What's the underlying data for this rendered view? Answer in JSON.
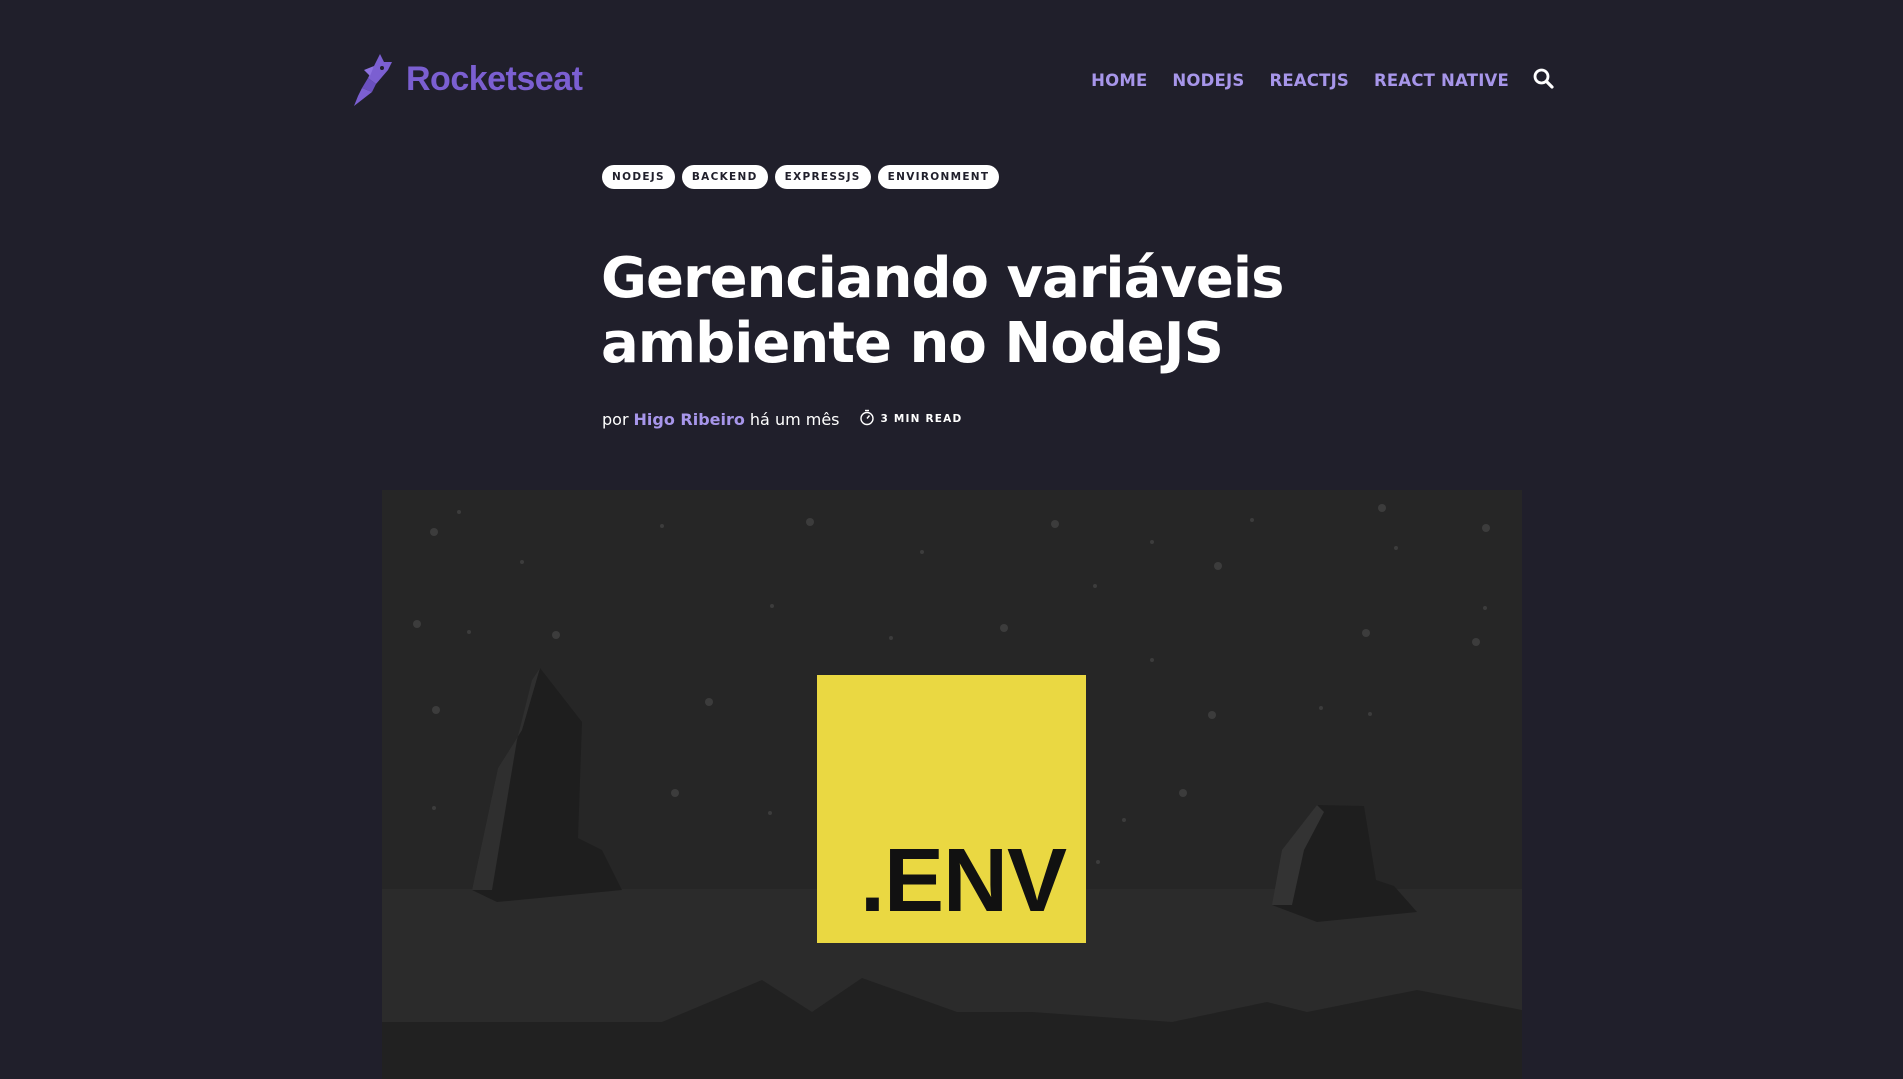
{
  "header": {
    "logo_text": "Rocketseat",
    "logo_icon": "rocket-icon",
    "nav": [
      {
        "label": "HOME"
      },
      {
        "label": "NODEJS"
      },
      {
        "label": "REACTJS"
      },
      {
        "label": "REACT NATIVE"
      }
    ],
    "search_icon": "search-icon"
  },
  "post": {
    "tags": [
      "NODEJS",
      "BACKEND",
      "EXPRESSJS",
      "ENVIRONMENT"
    ],
    "title": "Gerenciando variáveis ambiente no NodeJS",
    "byline": {
      "prefix": "por",
      "author": "Higo Ribeiro",
      "date": "há um mês",
      "read_time": "3 MIN READ",
      "read_time_icon": "stopwatch-icon"
    },
    "feature_image": {
      "badge_text": ".ENV"
    }
  },
  "colors": {
    "background": "#201f2b",
    "accent": "#7b5fd1",
    "nav_link": "#a796ea",
    "env_yellow": "#ead842"
  }
}
